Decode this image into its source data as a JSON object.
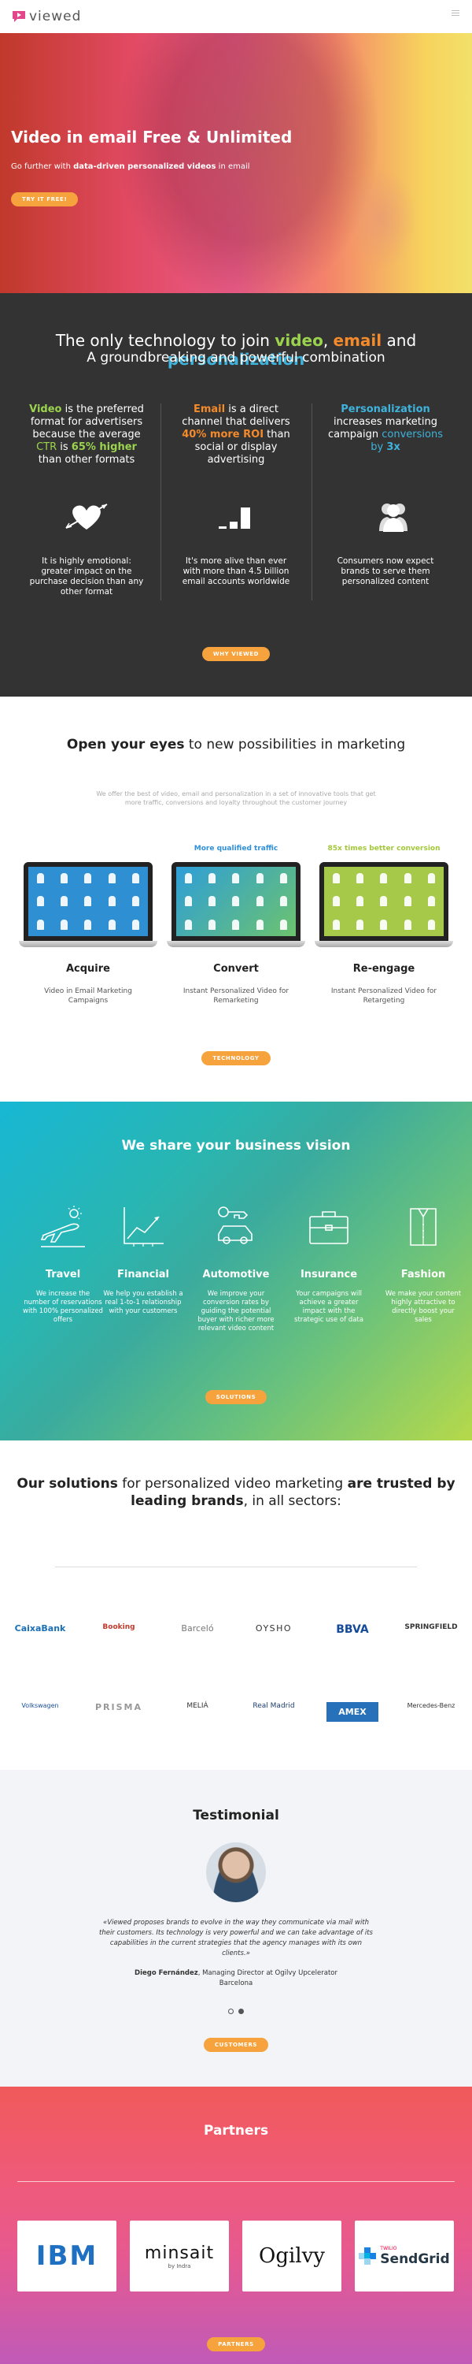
{
  "header": {
    "logo_text": "viewed"
  },
  "hero": {
    "title": "Video in email Free & Unlimited",
    "sub_prefix": "Go further with ",
    "sub_bold": "data-driven personalized videos",
    "sub_suffix": " in email",
    "cta": "TRY IT FREE!"
  },
  "dark": {
    "h1_prefix": "The only technology to join ",
    "h1_video": "video",
    "h1_sep": ", ",
    "h1_email": "email",
    "h1_and": " and ",
    "h1_personalization": "personalization",
    "h2": "A groundbreaking and powerful combination",
    "col1": {
      "accent": "Video",
      "text_a": " is the preferred format for advertisers because the average ",
      "ctr": "CTR",
      "text_b": " is ",
      "pct": "65% higher",
      "text_c": " than other formats"
    },
    "col2": {
      "accent": "Email",
      "text_a": " is a direct channel that delivers ",
      "roi": "40% more ROI",
      "text_b": " than social or display advertising"
    },
    "col3": {
      "accent": "Personalization",
      "text_a": " increases marketing campaign ",
      "conv": "conversions by ",
      "mult": "3x"
    },
    "note1": "It is highly emotional: greater impact on the purchase decision than any other format",
    "note2": "It's more alive than ever with more than 4.5 billion email accounts worldwide",
    "note3": "Consumers now expect brands to serve them personalized content",
    "cta": "WHY VIEWED"
  },
  "eyes": {
    "h_bold": "Open your eyes",
    "h_rest": " to new possibilities in marketing",
    "p": "We offer the best of video, email and personalization in a set of innovative tools that get more traffic, conversions and loyalty throughout the customer journey",
    "items": [
      {
        "tag": "",
        "title": "Acquire",
        "desc": "Video in Email Marketing Campaigns"
      },
      {
        "tag": "More qualified traffic",
        "title": "Convert",
        "desc": "Instant Personalized Video for Remarketing"
      },
      {
        "tag": "85x times better conversion",
        "title": "Re-engage",
        "desc": "Instant Personalized Video for Retargeting"
      }
    ],
    "cta": "TECHNOLOGY"
  },
  "vision": {
    "title": "We share your business vision",
    "sectors": [
      {
        "title": "Travel",
        "desc": "We increase the number of reservations with 100% personalized offers"
      },
      {
        "title": "Financial",
        "desc": "We help you establish a real 1-to-1 relationship with your customers"
      },
      {
        "title": "Automotive",
        "desc": "We improve your conversion rates by guiding the potential buyer with richer more relevant video content"
      },
      {
        "title": "Insurance",
        "desc": "Your campaigns will achieve a greater impact with the strategic use of data"
      },
      {
        "title": "Fashion",
        "desc": "We make your content highly attractive to directly boost your sales"
      }
    ],
    "cta": "SOLUTIONS"
  },
  "brands": {
    "h_a": "Our solutions",
    "h_b": " for personalized video marketing ",
    "h_c": "are trusted by leading brands",
    "h_d": ", in all sectors:",
    "row1": [
      "CaixaBank",
      "Booking",
      "Barceló",
      "OYSHO",
      "BBVA",
      "SPRINGFIELD"
    ],
    "row2": [
      "Volkswagen",
      "PRISMA",
      "MELIÁ",
      "Real Madrid",
      "AMEX",
      "Mercedes-Benz"
    ]
  },
  "testimonial": {
    "title": "Testimonial",
    "quote": "«Viewed proposes brands to evolve in the way they communicate via mail with their customers. Its technology is very powerful and we can take advantage of its capabilities in the current strategies that the agency manages with its own clients.»",
    "author_name": "Diego Fernández",
    "author_role": ", Managing Director at Ogilvy Upcelerator Barcelona",
    "cta": "CUSTOMERS"
  },
  "partners": {
    "title": "Partners",
    "items": [
      "IBM",
      "minsait",
      "Ogilvy",
      "SendGrid"
    ],
    "minsait_sub": "by Indra",
    "sendgrid_sub": "TWILIO",
    "cta": "PARTNERS"
  },
  "colors": {
    "accent": "#f6a23d",
    "green": "#9bd34f",
    "orange": "#f38a2b",
    "blue": "#3fb3dc",
    "dark": "#333333"
  }
}
